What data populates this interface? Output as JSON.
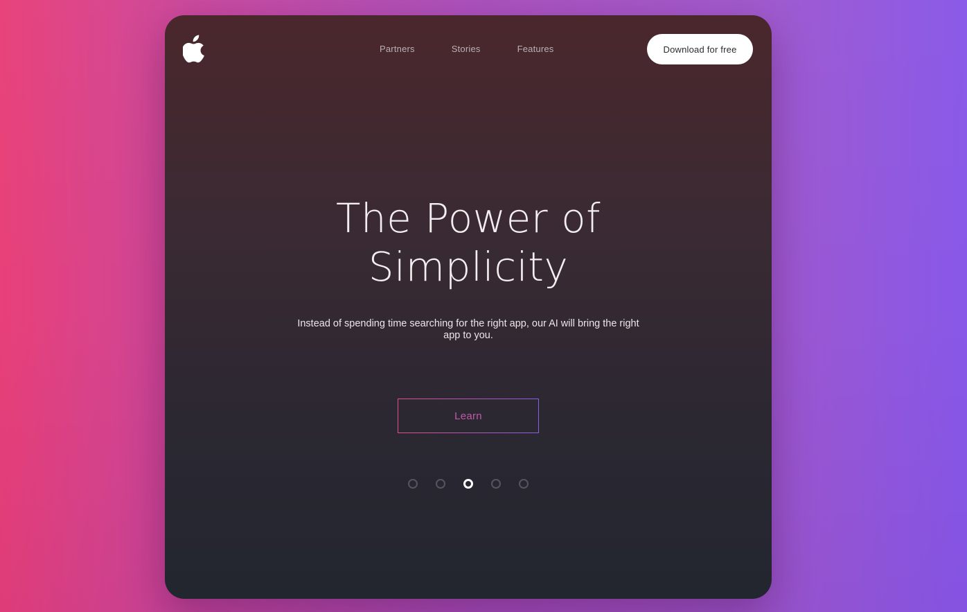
{
  "colors": {
    "background_left": "#e84078",
    "background_right": "#8858e8",
    "card_top": "#4a272c",
    "card_bottom": "#22262f",
    "accent_pink": "#e0508a",
    "accent_purple": "#8a5ee6"
  },
  "header": {
    "logo_icon": "apple-logo",
    "nav": [
      {
        "label": "Partners"
      },
      {
        "label": "Stories"
      },
      {
        "label": "Features"
      }
    ],
    "cta_label": "Download for free"
  },
  "hero": {
    "title_line1": "The Power of",
    "title_line2": "Simplicity",
    "subtitle": "Instead of spending time searching for the right app, our AI will bring the right app to you.",
    "button_label": "Learn"
  },
  "carousel": {
    "total_slides": 5,
    "active_slide": 3
  }
}
